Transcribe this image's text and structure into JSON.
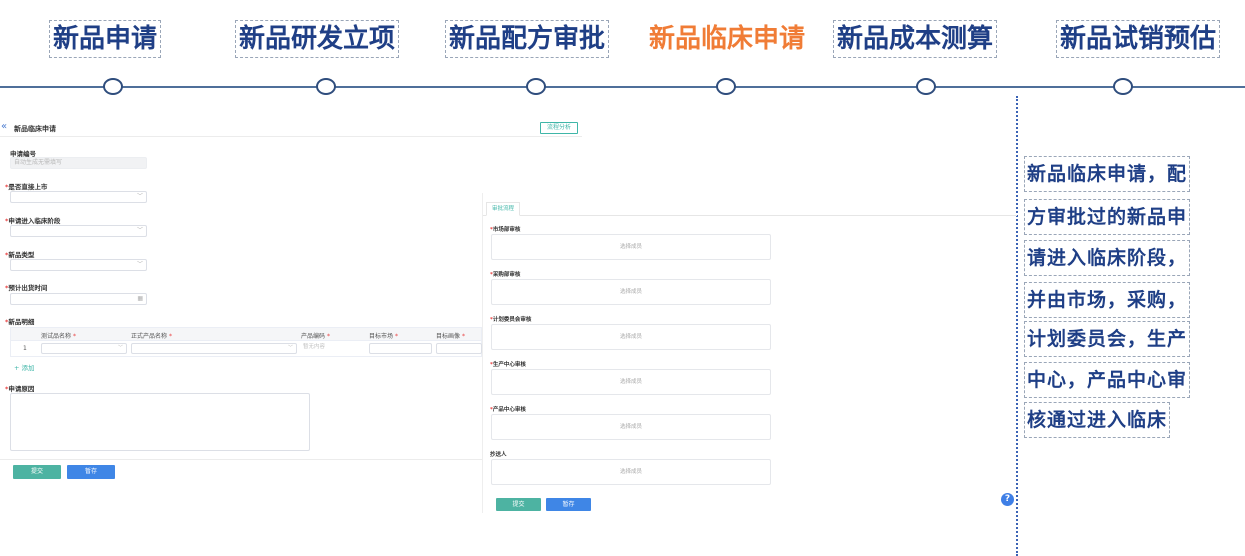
{
  "steps": [
    {
      "label": "新品申请"
    },
    {
      "label": "新品研发立项"
    },
    {
      "label": "新品配方审批"
    },
    {
      "label": "新品临床申请"
    },
    {
      "label": "新品成本测算"
    },
    {
      "label": "新品试销预估"
    }
  ],
  "note_lines": [
    "新品临床申请，配",
    "方审批过的新品申",
    "请进入临床阶段，",
    "并由市场，采购，",
    "计划委员会，生产",
    "中心，产品中心审",
    "核通过进入临床"
  ],
  "form": {
    "title": "新品临床申请",
    "flow_button": "流程分析",
    "collapse_icon": "«",
    "app_no": {
      "label": "申请编号",
      "placeholder": "自动生成无需填写"
    },
    "direct_market": {
      "label": "是否直接上市"
    },
    "clinical_stage": {
      "label": "申请进入临床阶段"
    },
    "product_type": {
      "label": "新品类型"
    },
    "expected_date": {
      "label": "预计出货时间"
    },
    "detail": {
      "label": "新品明细",
      "columns": [
        "测试品名称",
        "正式产品名称",
        "产品编码",
        "目标市场",
        "目标画像"
      ],
      "row_index": "1",
      "code_placeholder": "暂无内容",
      "add_label": "+ 添加"
    },
    "reason": {
      "label": "申请原因"
    },
    "submit": "提交",
    "save": "暂存"
  },
  "panel": {
    "tab": "审批流程",
    "approvers": [
      {
        "label": "市场部审核",
        "required": true,
        "placeholder": "选择成员"
      },
      {
        "label": "采购部审核",
        "required": true,
        "placeholder": "选择成员"
      },
      {
        "label": "计划委员会审核",
        "required": true,
        "placeholder": "选择成员"
      },
      {
        "label": "生产中心审核",
        "required": true,
        "placeholder": "选择成员"
      },
      {
        "label": "产品中心审核",
        "required": true,
        "placeholder": "选择成员"
      },
      {
        "label": "抄送人",
        "required": false,
        "placeholder": "选择成员"
      }
    ],
    "submit": "提交",
    "save": "暂存"
  },
  "help": "?",
  "colors": {
    "primary": "#1f3f86",
    "active": "#f07c36",
    "teal": "#4db3a2",
    "blue": "#3f86e6"
  }
}
